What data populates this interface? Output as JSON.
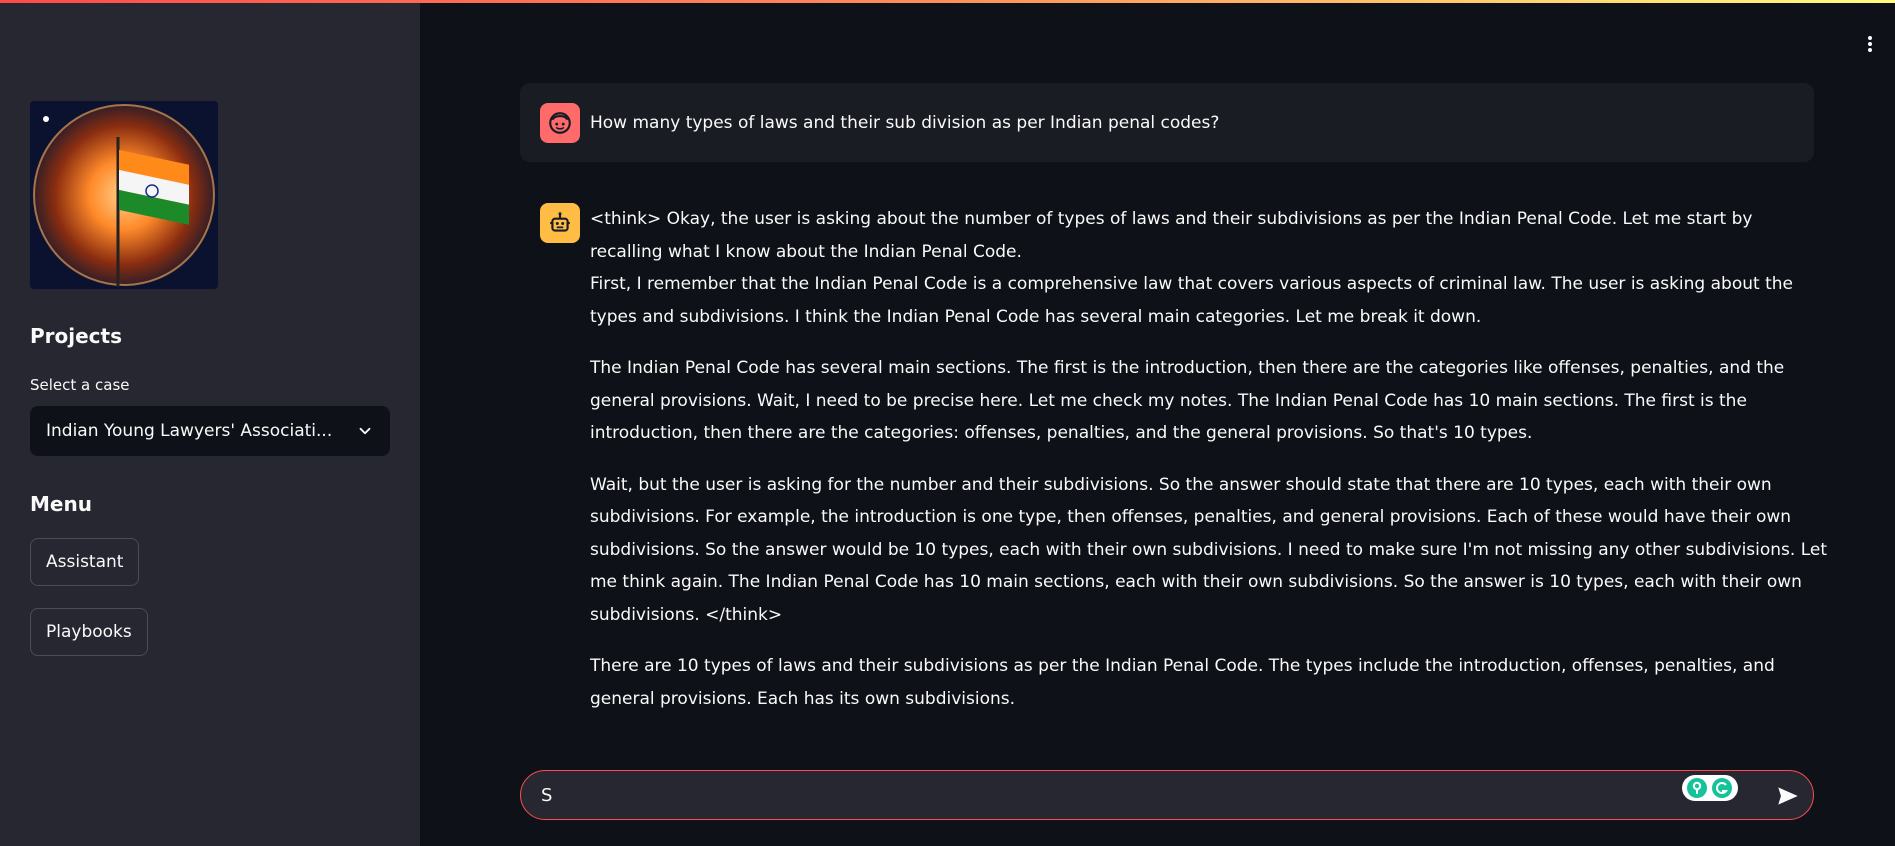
{
  "sidebar": {
    "projects_heading": "Projects",
    "select_label": "Select a case",
    "select_value": "Indian Young Lawyers' Associati...",
    "menu_heading": "Menu",
    "menu_items": [
      {
        "label": "Assistant"
      },
      {
        "label": "Playbooks"
      }
    ]
  },
  "chat": {
    "user_message": "How many types of laws and their sub division as per Indian penal codes?",
    "assistant_paragraphs": [
      "<think> Okay, the user is asking about the number of types of laws and their subdivisions as per the Indian Penal Code. Let me start by recalling what I know about the Indian Penal Code.",
      "First, I remember that the Indian Penal Code is a comprehensive law that covers various aspects of criminal law. The user is asking about the types and subdivisions. I think the Indian Penal Code has several main categories. Let me break it down.",
      "The Indian Penal Code has several main sections. The first is the introduction, then there are the categories like offenses, penalties, and the general provisions. Wait, I need to be precise here. Let me check my notes. The Indian Penal Code has 10 main sections. The first is the introduction, then there are the categories: offenses, penalties, and the general provisions. So that's 10 types.",
      "Wait, but the user is asking for the number and their subdivisions. So the answer should state that there are 10 types, each with their own subdivisions. For example, the introduction is one type, then offenses, penalties, and general provisions. Each of these would have their own subdivisions. So the answer would be 10 types, each with their own subdivisions. I need to make sure I'm not missing any other subdivisions. Let me think again. The Indian Penal Code has 10 main sections, each with their own subdivisions. So the answer is 10 types, each with their own subdivisions. </think>",
      "There are 10 types of laws and their subdivisions as per the Indian Penal Code. The types include the introduction, offenses, penalties, and general provisions. Each has its own subdivisions."
    ],
    "input_value": "S"
  },
  "colors": {
    "accent": "#ff4b4b",
    "sidebar_bg": "#262730",
    "main_bg": "#0e1117",
    "user_avatar": "#ff6b6b",
    "assistant_avatar": "#ffbd45"
  },
  "icons": {
    "user": "user-face-icon",
    "assistant": "robot-icon",
    "send": "send-icon",
    "menu": "kebab-menu-icon",
    "select": "chevron-down-icon"
  }
}
